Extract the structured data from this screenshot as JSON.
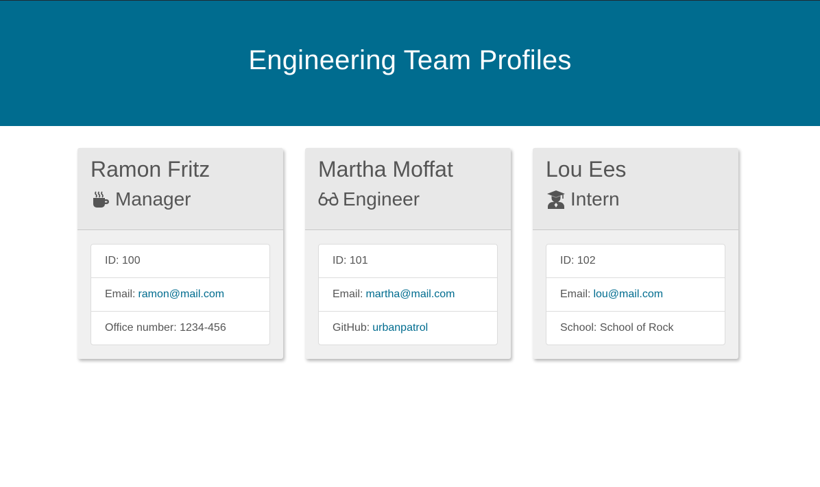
{
  "page": {
    "title": "Engineering Team Profiles"
  },
  "colors": {
    "banner": "#006c8f",
    "link": "#006c8f",
    "card_header": "#e8e8e8",
    "card_body": "#f0f0f0",
    "text": "#555555"
  },
  "team": [
    {
      "name": "Ramon Fritz",
      "role": "Manager",
      "icon": "coffee-mug-icon",
      "id_label": "ID:",
      "id": "100",
      "email_label": "Email:",
      "email": "ramon@mail.com",
      "extra_label": "Office number:",
      "extra_value": "1234-456"
    },
    {
      "name": "Martha Moffat",
      "role": "Engineer",
      "icon": "glasses-icon",
      "id_label": "ID:",
      "id": "101",
      "email_label": "Email:",
      "email": "martha@mail.com",
      "extra_label": "GitHub:",
      "extra_value": "urbanpatrol"
    },
    {
      "name": "Lou Ees",
      "role": "Intern",
      "icon": "graduate-icon",
      "id_label": "ID:",
      "id": "102",
      "email_label": "Email:",
      "email": "lou@mail.com",
      "extra_label": "School:",
      "extra_value": "School of Rock"
    }
  ]
}
